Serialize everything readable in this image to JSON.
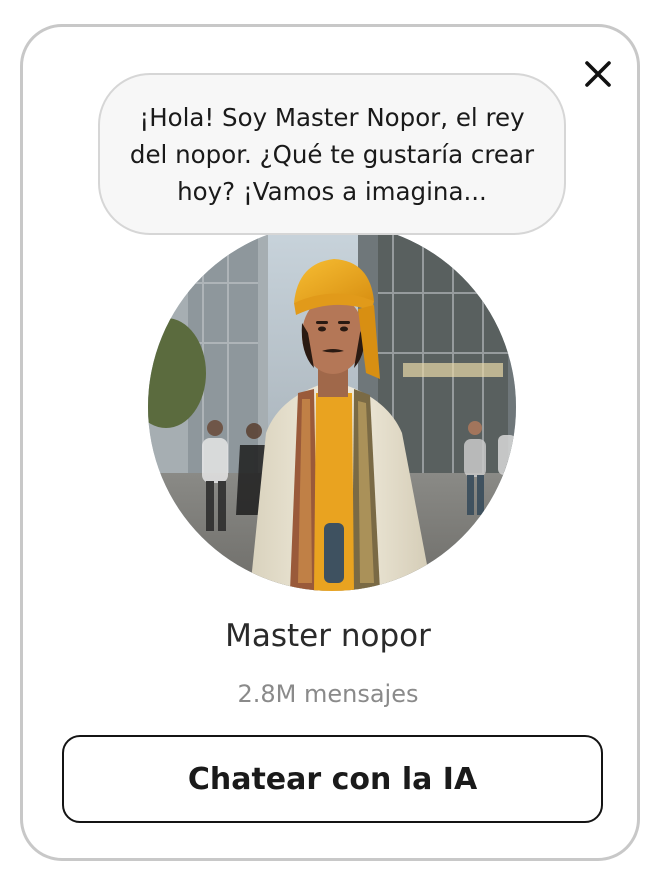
{
  "dialog": {
    "close_icon": "close-icon",
    "speech_bubble": "¡Hola! Soy Master Nopor, el rey del nopor. ¿Qué te gustaría crear hoy? ¡Vamos a imagina...",
    "avatar_icon": "avatar-photo",
    "character_name": "Master nopor",
    "message_count": "2.8M mensajes",
    "cta_label": "Chatear con la IA"
  },
  "colors": {
    "card_border": "#c8c8c8",
    "bubble_bg": "#f7f7f7",
    "bubble_border": "#d6d6d6",
    "turban": "#f0a81c",
    "robe": "#efe9d6",
    "text_primary": "#1a1a1a",
    "text_secondary": "#8a8a8a"
  }
}
